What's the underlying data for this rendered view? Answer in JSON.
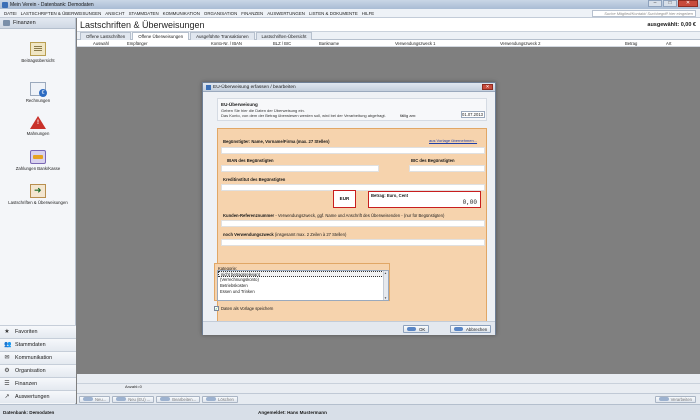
{
  "window": {
    "title": "Mein Verein - Datenbank: Demodaten"
  },
  "menu": {
    "items": [
      "DATEI",
      "LASTSCHRIFTEN & ÜBERWEISUNGEN",
      "ANSICHT",
      "STAMMDATEN",
      "KOMMUNIKATION",
      "ORGANISATION",
      "FINANZEN",
      "AUSWERTUNGEN",
      "LISTEN & DOKUMENTE",
      "HILFE"
    ],
    "search_placeholder": "Suche Mitglied/Kontakt/ Suchbegriff hier eingeben"
  },
  "sidebar": {
    "header": "Finanzen",
    "items": [
      {
        "label": "Beitragsübersicht",
        "icon": "document-icon"
      },
      {
        "label": "Rechnungen",
        "icon": "invoice-icon"
      },
      {
        "label": "Mahnungen",
        "icon": "warning-icon"
      },
      {
        "label": "Zahlungen Bank/Kasse",
        "icon": "cash-icon"
      },
      {
        "label": "Lastschriften & Überweisungen",
        "icon": "transfer-icon"
      }
    ],
    "nav": [
      {
        "label": "Favoriten",
        "icon": "★"
      },
      {
        "label": "Stammdaten",
        "icon": "👥"
      },
      {
        "label": "Kommunikation",
        "icon": "✉"
      },
      {
        "label": "Organisation",
        "icon": "⚙"
      },
      {
        "label": "Finanzen",
        "icon": "☰"
      },
      {
        "label": "Auswertungen",
        "icon": "↗"
      }
    ],
    "footer": ""
  },
  "main": {
    "title": "Lastschriften & Überweisungen",
    "saldo": "ausgewählt: 0,00 €",
    "tabs": [
      "Offene Lastschriften",
      "Offene Überweisungen",
      "Ausgeführte Transaktionen",
      "Lastschriften-Übersicht"
    ],
    "active_tab": 1,
    "columns": [
      "Auswahl",
      "Empfänger",
      "Konto-Nr. / IBAN",
      "BLZ / BIC",
      "Bankname",
      "Verwendungszweck 1",
      "Verwendungszweck 2",
      "Betrag",
      "Art"
    ],
    "status": "Anzahl=0"
  },
  "actions": {
    "new": "Neu...",
    "new_eu": "Neu (EU) ...",
    "edit": "Bearbeiten...",
    "delete": "Löschen",
    "process": "Verarbeiten"
  },
  "appstatus": {
    "database": "Datenbank: Demodaten",
    "user": "Angemeldet: Hans Mustermann"
  },
  "dialog": {
    "title": "EU-Überweisung erfassen / bearbeiten",
    "intro_heading": "EU-Überweisung",
    "intro_line1": "Geben Sie hier die Daten der Überweisung ein.",
    "intro_line2": "Das Konto, von dem der Betrag überwiesen werden soll, wird bei der Verarbeitung abgefragt.",
    "due_label": "fällig am:",
    "due_value": "01.07.2013",
    "beneficiary_label": "Begünstigter: Name, Vorname/Firma (max. 27 Stellen)",
    "template_link": "aus Vorlage übernehmen...",
    "iban_label": "IBAN des Begünstigten",
    "bic_label": "BIC des Begünstigten",
    "bank_label": "Kreditinstitut des Begünstigten",
    "currency": "EUR",
    "amount_label": "Betrag: Euro, Cent",
    "amount_value": "0,00",
    "reference_label": "Kunden-Referenznummer",
    "reference_hint": " - Verwendungszweck, ggf. Name und Anschrift des Überweisenden - (nur für Begünstigten)",
    "purpose_label": "noch Verwendungszweck",
    "purpose_hint": " (insgesamt max. 2 Zeilen à 27 Stellen)",
    "category_label": "Kategorie:",
    "categories": [
      "nicht betragsrelevant",
      "(Verrechnungskonto)",
      "Betriebskosten",
      "Essen und Trinken"
    ],
    "selected_category": 0,
    "save_template_label": "Daten als Vorlage speichern",
    "ok_label": "OK",
    "cancel_label": "Abbrechen"
  }
}
